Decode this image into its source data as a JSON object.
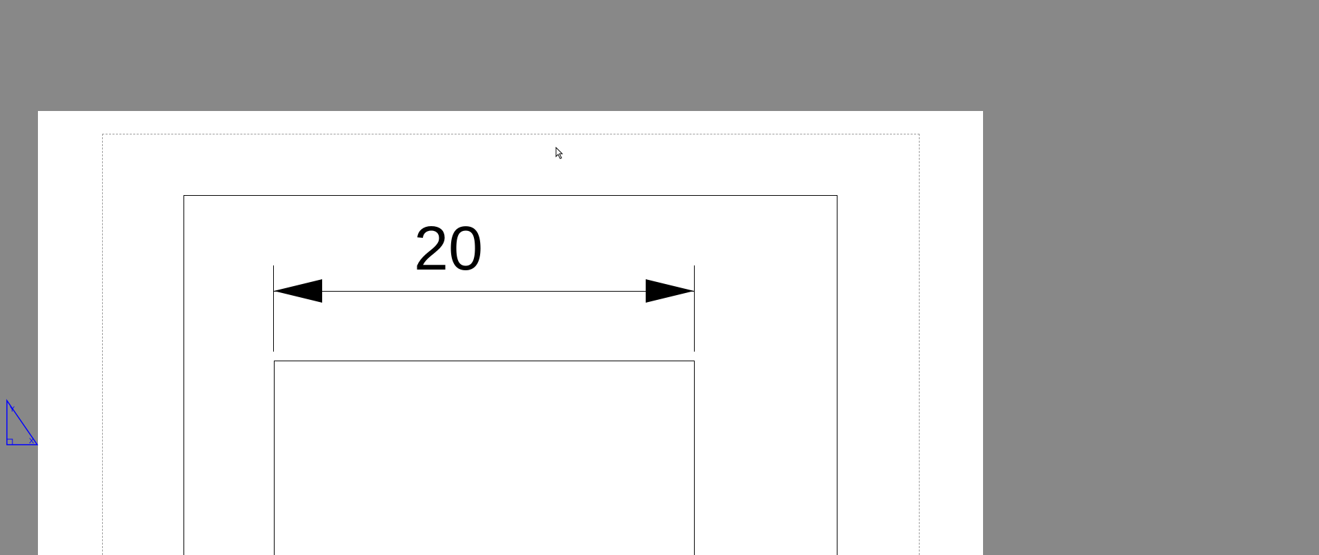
{
  "canvas": {
    "background_color": "#888888",
    "paper_color": "#ffffff"
  },
  "drawing": {
    "dimension": {
      "value": "20"
    }
  },
  "ucs": {
    "x_label": "X",
    "y_label": "Y"
  }
}
